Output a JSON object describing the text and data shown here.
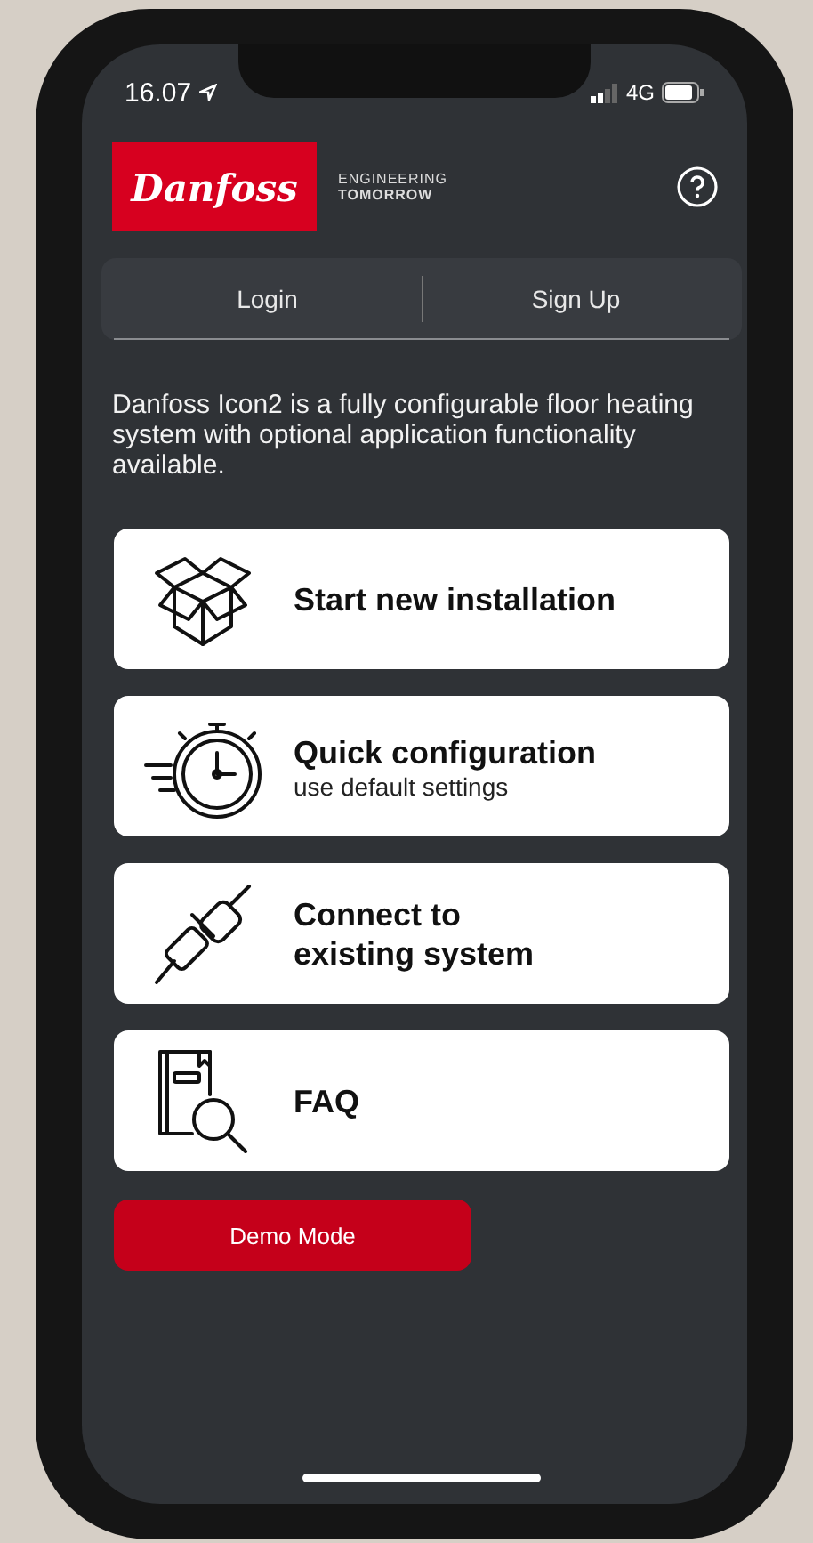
{
  "status_bar": {
    "time": "16.07",
    "network": "4G"
  },
  "header": {
    "logo": "Danfoss",
    "tagline": [
      "ENGINEERING",
      "TOMORROW"
    ]
  },
  "tabs": [
    {
      "label": "Login"
    },
    {
      "label": "Sign Up"
    }
  ],
  "description": "Danfoss Icon2 is a fully configurable floor heating system with optional application functionality available.",
  "actions": [
    {
      "kind": "box",
      "title": "Start new installation"
    },
    {
      "kind": "stopwatch",
      "title": "Quick configuration",
      "subtitle": "use default settings"
    },
    {
      "kind": "plug",
      "title": "Connect to\nexisting system"
    },
    {
      "kind": "book",
      "title": "FAQ"
    }
  ],
  "demo_button": "Demo Mode"
}
